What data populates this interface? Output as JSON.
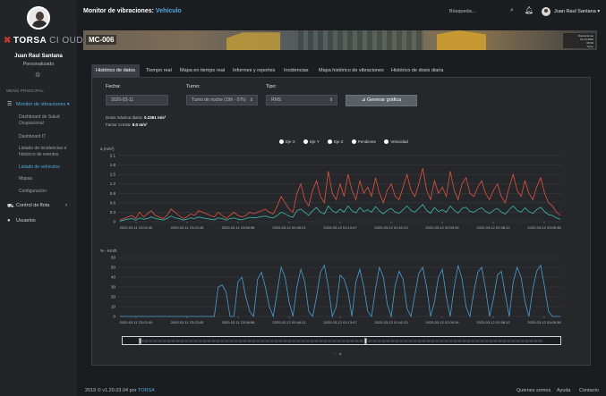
{
  "app": {
    "logo_text": "TORSA",
    "logo_suffix": "CI OUD"
  },
  "user": {
    "name": "Juan Raul Santana",
    "role": "Personalizado",
    "top_name": "Juan Raul Santana"
  },
  "sidebar": {
    "menu_header": "MENÚ PRINCIPAL",
    "items": [
      {
        "label": "Monitor de vibraciones",
        "icon": "list-icon"
      },
      {
        "label": "Control de flota",
        "icon": "truck-icon"
      },
      {
        "label": "Usuarios",
        "icon": "user-icon"
      }
    ],
    "subitems": [
      {
        "label": "Dashboard de Salud Ocupacional"
      },
      {
        "label": "Dashboard IT"
      },
      {
        "label": "Listado de incidencias e histórico de eventos"
      },
      {
        "label": "Listado de vehículos"
      },
      {
        "label": "Mapas"
      },
      {
        "label": "Configuración"
      }
    ]
  },
  "header": {
    "title": "Monitor de vibraciones:",
    "title_accent": "Vehículo",
    "search_placeholder": "Búsqueda..."
  },
  "banner": {
    "vehicle_id": "MC-006",
    "info_lines": [
      "Operaciones",
      "10.10.2020",
      "08:00",
      "Turno"
    ]
  },
  "tabs": [
    {
      "label": "Histórico de datos",
      "active": true
    },
    {
      "label": "Tiempo real",
      "active": false
    },
    {
      "label": "Mapa en tiempo real",
      "active": false
    },
    {
      "label": "Informes y reportes",
      "active": false
    },
    {
      "label": "Incidencias",
      "active": false
    },
    {
      "label": "Mapa histórico de vibraciones",
      "active": false
    },
    {
      "label": "Histórico de dosis diaria",
      "active": false
    }
  ],
  "filters": {
    "fecha_label": "Fecha:",
    "fecha_value": "2020-03-11",
    "turno_label": "Turno:",
    "turno_value": "Turno de noche (19h - 07h)",
    "tipo_label": "Tipo:",
    "tipo_value": "RMS",
    "generate_label": "Generar gráfica"
  },
  "info": {
    "dosis_label": "Dosis máxima diaria:",
    "dosis_value": "0.2361 m/s²",
    "cresta_label": "Factor Cresta:",
    "cresta_value": "8.0 m/s²"
  },
  "colors": {
    "accent": "#4ea8de",
    "series_red": "#e0533f",
    "series_teal": "#3fb8a8",
    "series_blue": "#4a9fd1"
  },
  "chart_data": [
    {
      "type": "line",
      "ylabel": "a (m/s²)",
      "ylim": [
        0,
        2.1
      ],
      "yticks": [
        "2.1",
        "1.8",
        "1.5",
        "1.2",
        "0.9",
        "0.6",
        "0.3",
        "0"
      ],
      "x_tick_labels": [
        "2020-03-11 23:02:40",
        "2020-03-11 23:23:45",
        "2020-03-11 23:56:58",
        "2020-03-12 00:46:21",
        "2020-03-12 01:13:47",
        "2020-03-12 01:41:23",
        "2020-03-12 02:09:34",
        "2020-03-12 02:38:12",
        "2020-03-12 03:05:38"
      ],
      "legend": [
        "Eje X",
        "Eje Y",
        "Eje Z",
        "Pendiente",
        "Velocidad"
      ],
      "series": [
        {
          "name": "Eje Z",
          "color": "#e0533f",
          "values": [
            0.05,
            0.1,
            0.15,
            0.2,
            0.1,
            0.3,
            0.15,
            0.25,
            0.35,
            0.2,
            0.15,
            0.1,
            0.2,
            0.4,
            0.3,
            0.2,
            0.1,
            0.15,
            0.25,
            0.2,
            0.35,
            0.3,
            0.25,
            0.2,
            0.15,
            0.3,
            0.2,
            0.1,
            0.2,
            0.3,
            0.2,
            0.15,
            0.2,
            0.3,
            0.25,
            0.3,
            0.35,
            0.4,
            0.3,
            0.25,
            0.5,
            0.8,
            0.6,
            0.4,
            0.3,
            0.9,
            1.2,
            0.7,
            0.5,
            1.0,
            1.3,
            0.8,
            0.6,
            1.6,
            0.9,
            0.7,
            1.2,
            0.8,
            1.5,
            1.0,
            0.7,
            1.3,
            0.9,
            1.1,
            0.8,
            1.4,
            0.9,
            0.6,
            1.0,
            1.2,
            0.8,
            0.7,
            1.1,
            1.5,
            1.0,
            0.8,
            1.2,
            1.7,
            1.0,
            0.7,
            1.3,
            0.9,
            1.1,
            0.8,
            1.6,
            1.0,
            0.7,
            1.2,
            1.4,
            0.9,
            0.8,
            1.1,
            1.3,
            0.9,
            0.7,
            1.0,
            1.2,
            0.8,
            0.6,
            1.1,
            1.5,
            1.0,
            0.8,
            1.3,
            0.9,
            0.7,
            1.1,
            1.4,
            0.9,
            0.6,
            0.5,
            0.3,
            0.2
          ]
        },
        {
          "name": "Eje X",
          "color": "#3fb8a8",
          "values": [
            0.02,
            0.05,
            0.08,
            0.1,
            0.05,
            0.12,
            0.08,
            0.1,
            0.15,
            0.1,
            0.08,
            0.05,
            0.1,
            0.18,
            0.12,
            0.1,
            0.05,
            0.08,
            0.12,
            0.1,
            0.15,
            0.12,
            0.1,
            0.08,
            0.06,
            0.12,
            0.1,
            0.05,
            0.1,
            0.12,
            0.08,
            0.06,
            0.1,
            0.14,
            0.12,
            0.14,
            0.16,
            0.18,
            0.14,
            0.12,
            0.2,
            0.3,
            0.25,
            0.18,
            0.14,
            0.35,
            0.4,
            0.3,
            0.2,
            0.35,
            0.45,
            0.3,
            0.25,
            0.5,
            0.35,
            0.28,
            0.4,
            0.3,
            0.5,
            0.35,
            0.28,
            0.45,
            0.32,
            0.38,
            0.3,
            0.48,
            0.34,
            0.25,
            0.36,
            0.42,
            0.3,
            0.27,
            0.38,
            0.5,
            0.36,
            0.3,
            0.42,
            0.55,
            0.36,
            0.27,
            0.45,
            0.32,
            0.38,
            0.3,
            0.5,
            0.36,
            0.27,
            0.42,
            0.46,
            0.33,
            0.3,
            0.39,
            0.44,
            0.33,
            0.26,
            0.36,
            0.42,
            0.3,
            0.24,
            0.38,
            0.5,
            0.36,
            0.3,
            0.44,
            0.32,
            0.26,
            0.38,
            0.46,
            0.32,
            0.22,
            0.2,
            0.12,
            0.08
          ]
        }
      ]
    },
    {
      "type": "line",
      "ylabel": "% - Km/h",
      "ylim": [
        0,
        60
      ],
      "yticks": [
        "60",
        "50",
        "40",
        "30",
        "20",
        "10",
        "0"
      ],
      "x_tick_labels": [
        "2020-03-11 23:02:40",
        "2020-03-11 23:23:45",
        "2020-03-11 23:56:58",
        "2020-03-12 00:46:21",
        "2020-03-12 01:13:47",
        "2020-03-12 01:41:23",
        "2020-03-12 02:09:34",
        "2020-03-12 02:38:12",
        "2020-03-12 03:05:38"
      ],
      "series": [
        {
          "name": "Velocidad",
          "color": "#4a9fd1",
          "values": [
            0,
            0,
            0,
            0,
            0,
            0,
            0,
            0,
            0,
            0,
            0,
            0,
            0,
            0,
            0,
            0,
            0,
            0,
            0,
            0,
            0,
            0,
            0,
            0,
            0,
            30,
            32,
            25,
            0,
            0,
            35,
            40,
            20,
            5,
            0,
            38,
            45,
            30,
            10,
            0,
            25,
            50,
            40,
            15,
            0,
            30,
            48,
            35,
            5,
            0,
            20,
            45,
            52,
            30,
            0,
            10,
            42,
            38,
            25,
            0,
            35,
            48,
            30,
            5,
            0,
            28,
            50,
            40,
            12,
            0,
            32,
            46,
            38,
            8,
            0,
            22,
            44,
            50,
            30,
            0,
            15,
            40,
            48,
            20,
            0,
            30,
            52,
            38,
            10,
            0,
            25,
            45,
            50,
            28,
            0,
            18,
            42,
            46,
            22,
            0,
            35,
            50,
            40,
            15,
            0,
            28,
            46,
            52,
            30,
            5,
            0,
            0,
            0
          ]
        }
      ]
    }
  ],
  "footer": {
    "copyright": "2019 © v1.20.03.04 por",
    "company": "TORSA",
    "links": [
      "Quienes somos",
      "Ayuda",
      "Contacto"
    ]
  }
}
